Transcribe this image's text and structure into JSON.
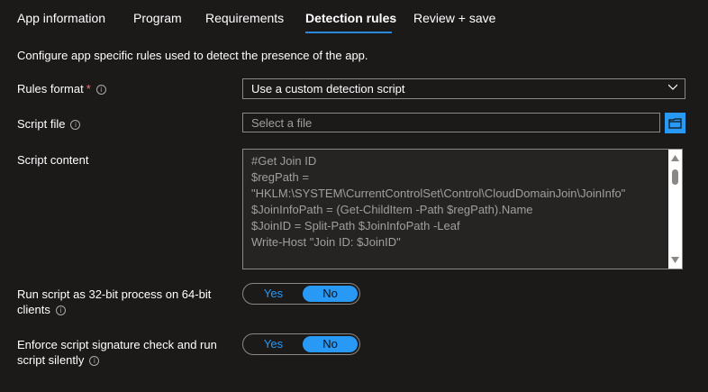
{
  "tabs": [
    {
      "label": "App information"
    },
    {
      "label": "Program"
    },
    {
      "label": "Requirements"
    },
    {
      "label": "Detection rules"
    },
    {
      "label": "Review + save"
    }
  ],
  "description": "Configure app specific rules used to detect the presence of the app.",
  "rules_format": {
    "label": "Rules format",
    "required": "*",
    "value": "Use a custom detection script"
  },
  "script_file": {
    "label": "Script file",
    "placeholder": "Select a file"
  },
  "script_content": {
    "label": "Script content",
    "lines": [
      "#Get Join ID",
      "$regPath =",
      "\"HKLM:\\SYSTEM\\CurrentControlSet\\Control\\CloudDomainJoin\\JoinInfo\"",
      "$JoinInfoPath = (Get-ChildItem -Path $regPath).Name",
      "$JoinID = Split-Path $JoinInfoPath -Leaf",
      "Write-Host \"Join ID: $JoinID\""
    ]
  },
  "run32": {
    "label_line1": "Run script as 32-bit process on 64-bit",
    "label_line2": "clients",
    "yes": "Yes",
    "no": "No",
    "selected": "No"
  },
  "enforce": {
    "label_line1": "Enforce script signature check and run",
    "label_line2": "script silently",
    "yes": "Yes",
    "no": "No",
    "selected": "No"
  },
  "info_glyph": "i",
  "colors": {
    "accent": "#2899f5",
    "background": "#1b1a19"
  }
}
